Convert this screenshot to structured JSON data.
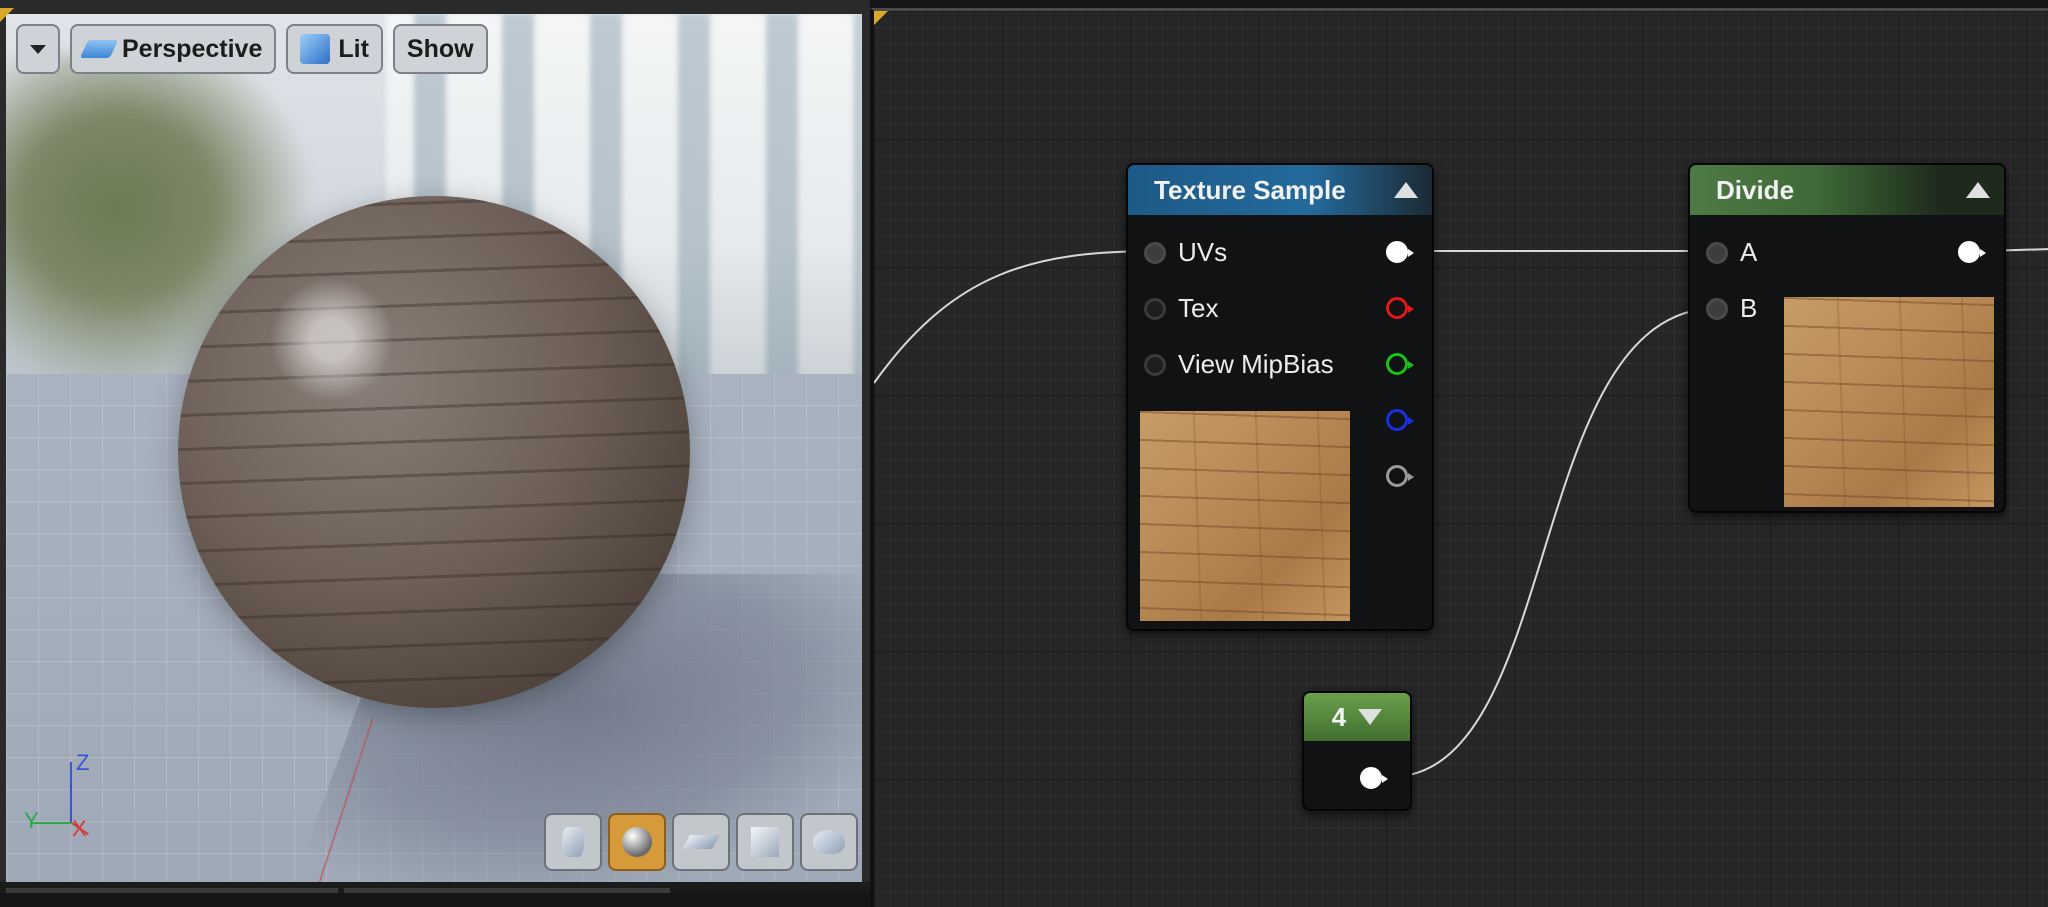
{
  "viewport": {
    "toolbar": {
      "menu_icon": "caret-down-icon",
      "perspective_label": "Perspective",
      "perspective_icon": "perspective-icon",
      "lit_label": "Lit",
      "lit_icon": "lit-cube-icon",
      "show_label": "Show"
    },
    "axis": {
      "z": "Z",
      "y": "Y",
      "x": "X"
    },
    "preview_shapes": [
      {
        "name": "cylinder-icon",
        "active": false
      },
      {
        "name": "sphere-icon",
        "active": true
      },
      {
        "name": "plane-icon",
        "active": false
      },
      {
        "name": "cube-icon",
        "active": false
      },
      {
        "name": "teapot-icon",
        "active": false
      }
    ]
  },
  "graph": {
    "texture_sample": {
      "title": "Texture Sample",
      "inputs": [
        "UVs",
        "Tex",
        "View MipBias"
      ],
      "output_colors": [
        "#ffffff",
        "#e01818",
        "#18c018",
        "#1830e0",
        "#9a9a9a"
      ]
    },
    "divide": {
      "title": "Divide",
      "inputs": [
        "A",
        "B"
      ],
      "output_color": "#ffffff"
    },
    "constant": {
      "value": "4"
    }
  },
  "colors": {
    "accent_orange": "#d69a3a",
    "header_blue": "#246a9d",
    "header_green": "#4e7a45"
  }
}
